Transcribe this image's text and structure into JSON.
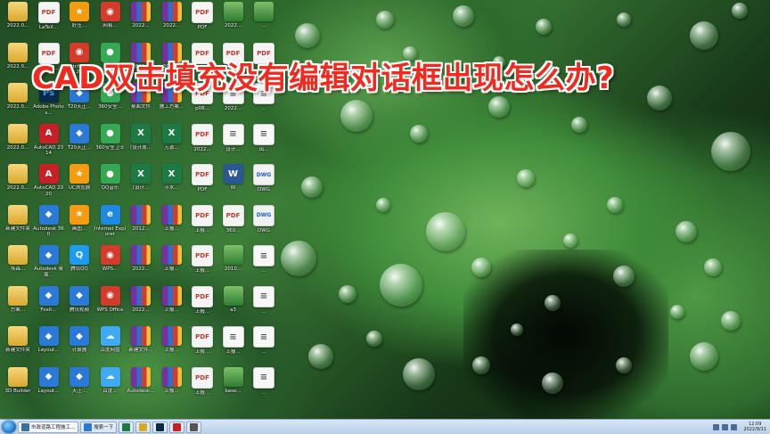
{
  "title": "CAD双击填充没有编辑对话框出现怎么办?",
  "desktop_icons": [
    {
      "label": "2022.0...",
      "icon": "folder-icon",
      "kind": "folder"
    },
    {
      "label": "2022.0...",
      "icon": "folder-icon",
      "kind": "folder"
    },
    {
      "label": "2022.0...",
      "icon": "folder-icon",
      "kind": "folder"
    },
    {
      "label": "2022.0...",
      "icon": "folder-icon",
      "kind": "folder"
    },
    {
      "label": "2022.0...",
      "icon": "folder-icon",
      "kind": "folder"
    },
    {
      "label": "新建文件夹",
      "icon": "folder-icon",
      "kind": "folder"
    },
    {
      "label": "埃森...",
      "icon": "folder-icon",
      "kind": "folder"
    },
    {
      "label": "方案...",
      "icon": "folder-icon",
      "kind": "folder"
    },
    {
      "label": "新建文件夹",
      "icon": "folder-icon",
      "kind": "folder"
    },
    {
      "label": "3D Builder",
      "icon": "folder-icon",
      "kind": "folder"
    },
    {
      "label": "LaTeX...",
      "icon": "pdf-icon",
      "kind": "pdf"
    },
    {
      "label": "Adobe...",
      "icon": "pdf-icon",
      "kind": "pdf"
    },
    {
      "label": "Adobe Photos...",
      "icon": "photoshop-icon",
      "kind": "ps"
    },
    {
      "label": "AutoCAD 2014",
      "icon": "autocad-icon",
      "kind": "autocad"
    },
    {
      "label": "AutoCAD 2020",
      "icon": "autocad-icon",
      "kind": "autocad"
    },
    {
      "label": "Autodesk 360",
      "icon": "autodesk-icon",
      "kind": "blue"
    },
    {
      "label": "Autodesk 桌面...",
      "icon": "autodesk-icon",
      "kind": "blue"
    },
    {
      "label": "Foxit...",
      "icon": "foxit-icon",
      "kind": "blue"
    },
    {
      "label": "Layout...",
      "icon": "layout-icon",
      "kind": "blue"
    },
    {
      "label": "Layout...",
      "icon": "layout-icon",
      "kind": "blue"
    },
    {
      "label": "好压...",
      "icon": "archive-icon",
      "kind": "orange"
    },
    {
      "label": "SketchUp 2022",
      "icon": "sketchup-icon",
      "kind": "red"
    },
    {
      "label": "T20天正...",
      "icon": "tangent-icon",
      "kind": "blue"
    },
    {
      "label": "T20天正...",
      "icon": "tangent-icon",
      "kind": "blue"
    },
    {
      "label": "UC浏览器",
      "icon": "browser-icon",
      "kind": "orange"
    },
    {
      "label": "画图...",
      "icon": "paint-icon",
      "kind": "orange"
    },
    {
      "label": "腾讯QQ",
      "icon": "qq-icon",
      "kind": "qq"
    },
    {
      "label": "腾讯视频",
      "icon": "video-icon",
      "kind": "blue"
    },
    {
      "label": "计算器",
      "icon": "calculator-icon",
      "kind": "blue"
    },
    {
      "label": "天正...",
      "icon": "tangent-icon",
      "kind": "blue"
    },
    {
      "label": "网易...",
      "icon": "netease-icon",
      "kind": "red"
    },
    {
      "label": "微信",
      "icon": "wechat-icon",
      "kind": "green"
    },
    {
      "label": "360安全...",
      "icon": "security-icon",
      "kind": "green"
    },
    {
      "label": "360安全卫士",
      "icon": "security-icon",
      "kind": "green"
    },
    {
      "label": "QQ音乐",
      "icon": "music-icon",
      "kind": "green"
    },
    {
      "label": "Internet Explorer",
      "icon": "ie-icon",
      "kind": "ie"
    },
    {
      "label": "WPS...",
      "icon": "wps-icon",
      "kind": "red"
    },
    {
      "label": "WPS Office",
      "icon": "wps-icon",
      "kind": "red"
    },
    {
      "label": "百度网盘",
      "icon": "cloud-icon",
      "kind": "cloud"
    },
    {
      "label": "百度...",
      "icon": "cloud-icon",
      "kind": "cloud"
    },
    {
      "label": "2022...",
      "icon": "archive-icon",
      "kind": "rar"
    },
    {
      "label": "2022...",
      "icon": "archive-icon",
      "kind": "rar"
    },
    {
      "label": "桌面文件",
      "icon": "archive-icon",
      "kind": "rar"
    },
    {
      "label": "(设计原...",
      "icon": "excel-icon",
      "kind": "excel"
    },
    {
      "label": "(设计...",
      "icon": "excel-icon",
      "kind": "excel"
    },
    {
      "label": "2012...",
      "icon": "archive-icon",
      "kind": "rar"
    },
    {
      "label": "2022...",
      "icon": "archive-icon",
      "kind": "rar"
    },
    {
      "label": "2022...",
      "icon": "archive-icon",
      "kind": "rar"
    },
    {
      "label": "新建文件...",
      "icon": "archive-icon",
      "kind": "rar"
    },
    {
      "label": "Autodesk...",
      "icon": "archive-icon",
      "kind": "rar"
    },
    {
      "label": "2022...",
      "icon": "archive-icon",
      "kind": "rar"
    },
    {
      "label": "2022...",
      "icon": "archive-icon",
      "kind": "rar"
    },
    {
      "label": "施工方案...",
      "icon": "archive-icon",
      "kind": "rar"
    },
    {
      "label": "万源...",
      "icon": "excel-icon",
      "kind": "excel"
    },
    {
      "label": "平水...",
      "icon": "excel-icon",
      "kind": "excel"
    },
    {
      "label": "上报...",
      "icon": "archive-icon",
      "kind": "rar"
    },
    {
      "label": "上报...",
      "icon": "archive-icon",
      "kind": "rar"
    },
    {
      "label": "上报...",
      "icon": "archive-icon",
      "kind": "rar"
    },
    {
      "label": "上报...",
      "icon": "archive-icon",
      "kind": "rar"
    },
    {
      "label": "上报...",
      "icon": "archive-icon",
      "kind": "rar"
    },
    {
      "label": "PDF",
      "icon": "pdf-icon",
      "kind": "pdf"
    },
    {
      "label": "PDF",
      "icon": "pdf-icon",
      "kind": "pdf"
    },
    {
      "label": "p08...",
      "icon": "pdf-icon",
      "kind": "pdf"
    },
    {
      "label": "2022...",
      "icon": "pdf-icon",
      "kind": "pdf"
    },
    {
      "label": "PDF",
      "icon": "pdf-icon",
      "kind": "pdf"
    },
    {
      "label": "上报...",
      "icon": "pdf-icon",
      "kind": "pdf"
    },
    {
      "label": "上报...",
      "icon": "pdf-icon",
      "kind": "pdf"
    },
    {
      "label": "上报...",
      "icon": "pdf-icon",
      "kind": "pdf"
    },
    {
      "label": "上报...",
      "icon": "pdf-icon",
      "kind": "pdf"
    },
    {
      "label": "上报...",
      "icon": "pdf-icon",
      "kind": "pdf"
    },
    {
      "label": "2022...",
      "icon": "image-icon",
      "kind": "img"
    },
    {
      "label": "PDF",
      "icon": "pdf-icon",
      "kind": "pdf"
    },
    {
      "label": "2022...",
      "icon": "doc-icon",
      "kind": "doc"
    },
    {
      "label": "设计...",
      "icon": "doc-icon",
      "kind": "doc"
    },
    {
      "label": "W",
      "icon": "word-icon",
      "kind": "word"
    },
    {
      "label": "360...",
      "icon": "pdf-icon",
      "kind": "pdf"
    },
    {
      "label": "2010...",
      "icon": "image-icon",
      "kind": "img"
    },
    {
      "label": "a3",
      "icon": "image-icon",
      "kind": "img"
    },
    {
      "label": "上报...",
      "icon": "doc-icon",
      "kind": "doc"
    },
    {
      "label": "base...",
      "icon": "image-icon",
      "kind": "img"
    },
    {
      "label": "...",
      "icon": "image-icon",
      "kind": "img"
    },
    {
      "label": "PDF",
      "icon": "pdf-icon",
      "kind": "pdf"
    },
    {
      "label": "...",
      "icon": "doc-icon",
      "kind": "doc"
    },
    {
      "label": "出...",
      "icon": "doc-icon",
      "kind": "doc"
    },
    {
      "label": "DWG",
      "icon": "dwg-icon",
      "kind": "dwg"
    },
    {
      "label": "DWG",
      "icon": "dwg-icon",
      "kind": "dwg"
    },
    {
      "label": "...",
      "icon": "doc-icon",
      "kind": "doc"
    },
    {
      "label": "...",
      "icon": "doc-icon",
      "kind": "doc"
    },
    {
      "label": "...",
      "icon": "doc-icon",
      "kind": "doc"
    },
    {
      "label": "...",
      "icon": "doc-icon",
      "kind": "doc"
    }
  ],
  "taskbar": {
    "items": [
      {
        "label": "市政道路工程施工...",
        "icon": "explorer-icon",
        "color": "#3a6ea5"
      },
      {
        "label": "搜索一下",
        "icon": "search-icon",
        "color": "#2a79d6"
      },
      {
        "label": "",
        "icon": "excel-icon",
        "color": "#1e7a45"
      },
      {
        "label": "",
        "icon": "folder-icon",
        "color": "#d9a82e"
      },
      {
        "label": "",
        "icon": "photoshop-icon",
        "color": "#0a2a4a"
      },
      {
        "label": "",
        "icon": "autocad-icon",
        "color": "#c72027"
      },
      {
        "label": "",
        "icon": "window-icon",
        "color": "#555"
      }
    ],
    "clock_time": "12:09",
    "clock_date": "2022/9/11"
  }
}
